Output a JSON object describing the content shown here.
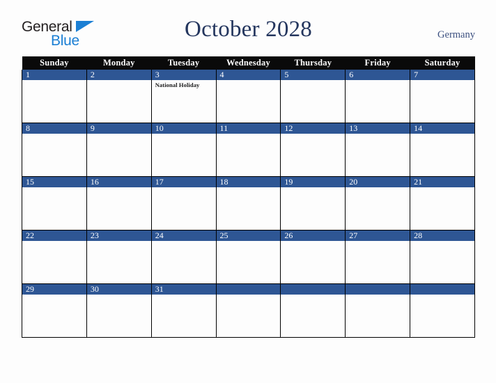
{
  "brand": {
    "name_part1": "General",
    "name_part2": "Blue",
    "triangle_icon": "triangle-icon",
    "accent_color": "#1b7fd4"
  },
  "header": {
    "title": "October 2028",
    "country": "Germany",
    "title_color": "#24365e",
    "country_color": "#3c5080"
  },
  "calendar": {
    "header_bg": "#0a0a0a",
    "daybar_bg": "#2e5694",
    "weekday_headers": [
      "Sunday",
      "Monday",
      "Tuesday",
      "Wednesday",
      "Thursday",
      "Friday",
      "Saturday"
    ],
    "weeks": [
      [
        {
          "day": "1",
          "events": []
        },
        {
          "day": "2",
          "events": []
        },
        {
          "day": "3",
          "events": [
            "National Holiday"
          ]
        },
        {
          "day": "4",
          "events": []
        },
        {
          "day": "5",
          "events": []
        },
        {
          "day": "6",
          "events": []
        },
        {
          "day": "7",
          "events": []
        }
      ],
      [
        {
          "day": "8",
          "events": []
        },
        {
          "day": "9",
          "events": []
        },
        {
          "day": "10",
          "events": []
        },
        {
          "day": "11",
          "events": []
        },
        {
          "day": "12",
          "events": []
        },
        {
          "day": "13",
          "events": []
        },
        {
          "day": "14",
          "events": []
        }
      ],
      [
        {
          "day": "15",
          "events": []
        },
        {
          "day": "16",
          "events": []
        },
        {
          "day": "17",
          "events": []
        },
        {
          "day": "18",
          "events": []
        },
        {
          "day": "19",
          "events": []
        },
        {
          "day": "20",
          "events": []
        },
        {
          "day": "21",
          "events": []
        }
      ],
      [
        {
          "day": "22",
          "events": []
        },
        {
          "day": "23",
          "events": []
        },
        {
          "day": "24",
          "events": []
        },
        {
          "day": "25",
          "events": []
        },
        {
          "day": "26",
          "events": []
        },
        {
          "day": "27",
          "events": []
        },
        {
          "day": "28",
          "events": []
        }
      ],
      [
        {
          "day": "29",
          "events": []
        },
        {
          "day": "30",
          "events": []
        },
        {
          "day": "31",
          "events": []
        },
        {
          "day": "",
          "events": []
        },
        {
          "day": "",
          "events": []
        },
        {
          "day": "",
          "events": []
        },
        {
          "day": "",
          "events": []
        }
      ]
    ]
  }
}
